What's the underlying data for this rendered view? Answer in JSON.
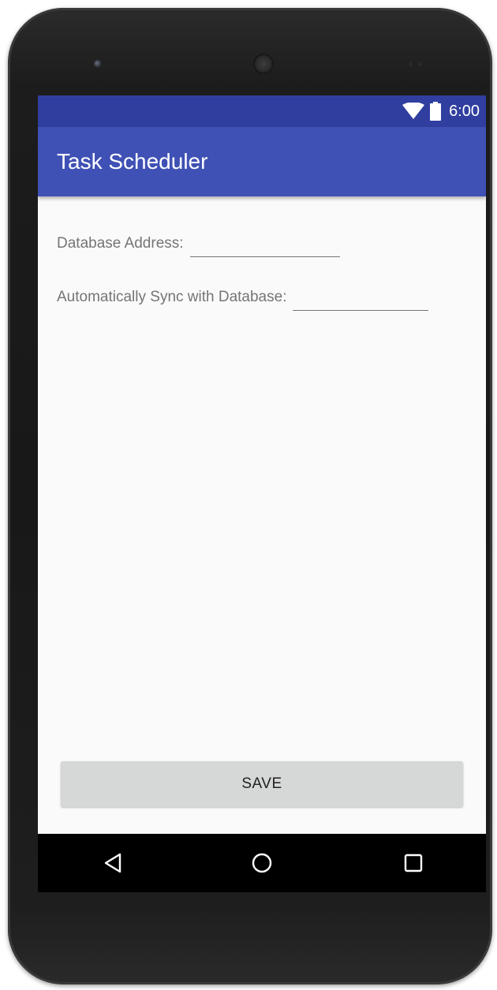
{
  "status_bar": {
    "time": "6:00",
    "icons": [
      "wifi-icon",
      "battery-icon"
    ],
    "color": "#303f9f"
  },
  "app_bar": {
    "title": "Task Scheduler",
    "color": "#3f51b5"
  },
  "form": {
    "fields": [
      {
        "label": "Database Address:",
        "value": "",
        "placeholder": ""
      },
      {
        "label": "Automatically Sync with Database:",
        "value": "",
        "placeholder": ""
      }
    ]
  },
  "actions": {
    "save_label": "SAVE"
  },
  "nav_bar": {
    "icons": [
      "back-icon",
      "home-icon",
      "recents-icon"
    ]
  }
}
